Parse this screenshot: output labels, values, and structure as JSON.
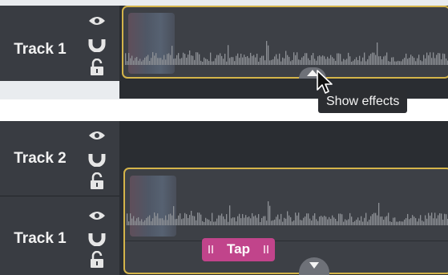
{
  "top_panel": {
    "track": {
      "label": "Track 1"
    },
    "tooltip": "Show effects"
  },
  "bottom_panel": {
    "tracks": [
      {
        "label": "Track 2"
      },
      {
        "label": "Track 1"
      }
    ],
    "effect": {
      "label": "Tap"
    }
  },
  "icons": [
    "eye-icon",
    "magnet-icon",
    "lock-icon",
    "chevron-up-icon",
    "chevron-down-icon",
    "mouse-pointer-icon"
  ],
  "colors": {
    "clip_border": "#d4b44a",
    "effect_tag": "#c1448b",
    "track_header": "#393c42",
    "timeline_bg": "#2a2d32"
  }
}
